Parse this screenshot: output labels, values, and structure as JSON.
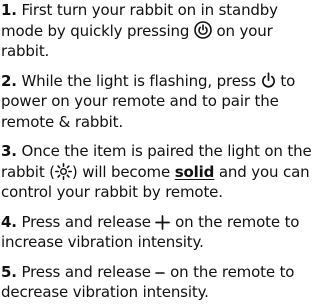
{
  "steps": [
    {
      "number": "1.",
      "text_a": "First turn your rabbit on in standby mode by quickly pressing",
      "icon": "power-button-circle-icon",
      "text_b": "on your rabbit."
    },
    {
      "number": "2.",
      "text_a": "While the light is flashing, press",
      "icon": "power-icon",
      "text_b": "to power on your remote and to pair the remote & rabbit."
    },
    {
      "number": "3.",
      "text_a": "Once the item is paired the light on the rabbit (",
      "icon": "light-sun-icon",
      "text_b": ") will become",
      "emphasis": "solid",
      "text_c": "and you can control your rabbit by remote."
    },
    {
      "number": "4.",
      "text_a": "Press and release",
      "icon": "plus-icon",
      "text_b": "on the remote to increase vibration intensity."
    },
    {
      "number": "5.",
      "text_a": "Press and release",
      "icon": "minus-icon",
      "text_b": "on the remote to decrease vibration intensity."
    }
  ]
}
